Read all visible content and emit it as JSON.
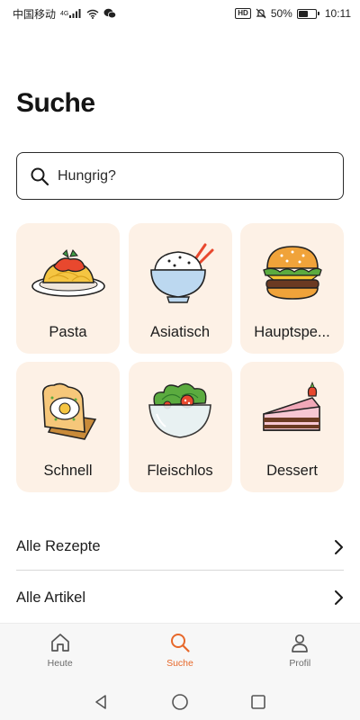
{
  "status_bar": {
    "carrier": "中国移动",
    "network": "4G",
    "battery_text": "50%",
    "battery_level": 0.5,
    "time": "10:11"
  },
  "page": {
    "title": "Suche"
  },
  "search": {
    "placeholder": "Hungrig?"
  },
  "categories": [
    {
      "label": "Pasta",
      "icon": "pasta-icon"
    },
    {
      "label": "Asiatisch",
      "icon": "rice-bowl-icon"
    },
    {
      "label": "Hauptspe...",
      "icon": "burger-icon"
    },
    {
      "label": "Schnell",
      "icon": "toast-egg-icon"
    },
    {
      "label": "Fleischlos",
      "icon": "salad-icon"
    },
    {
      "label": "Dessert",
      "icon": "cake-icon"
    }
  ],
  "links": [
    {
      "label": "Alle Rezepte"
    },
    {
      "label": "Alle Artikel"
    }
  ],
  "bottom_nav": {
    "items": [
      {
        "label": "Heute",
        "icon": "home-icon"
      },
      {
        "label": "Suche",
        "icon": "search-icon",
        "active": true
      },
      {
        "label": "Profil",
        "icon": "profile-icon"
      }
    ]
  },
  "colors": {
    "accent": "#e7682a",
    "tile_background": "#fdf1e6",
    "text": "#1c1c1c"
  }
}
